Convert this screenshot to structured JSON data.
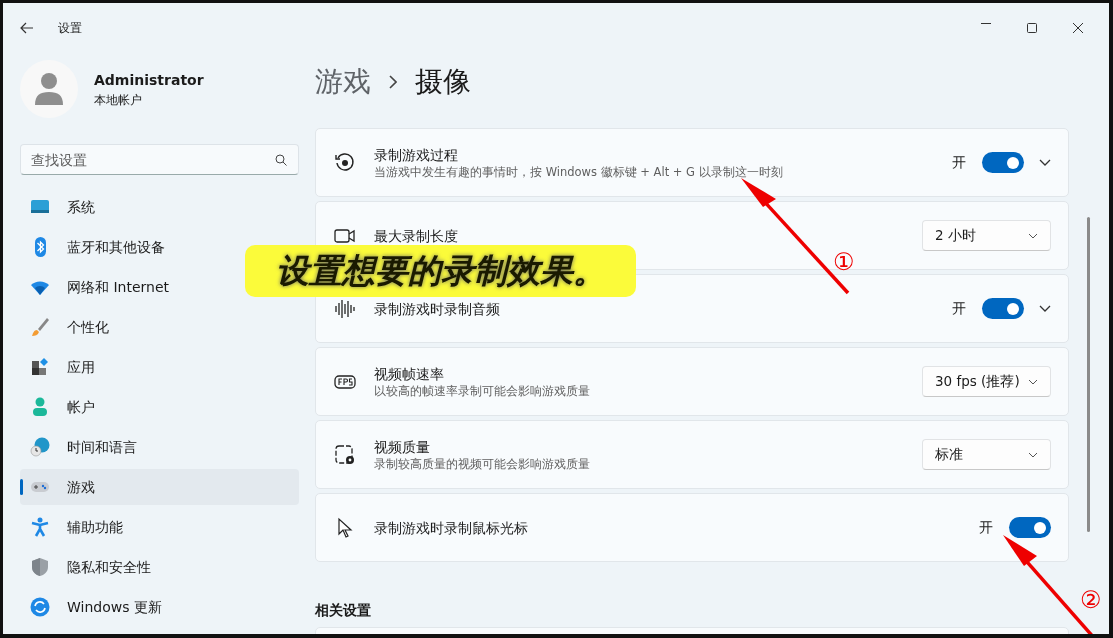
{
  "window": {
    "title": "设置"
  },
  "profile": {
    "name": "Administrator",
    "account_type": "本地帐户"
  },
  "search": {
    "placeholder": "查找设置"
  },
  "sidebar": {
    "items": [
      {
        "label": "系统",
        "selected": false
      },
      {
        "label": "蓝牙和其他设备",
        "selected": false
      },
      {
        "label": "网络和 Internet",
        "selected": false
      },
      {
        "label": "个性化",
        "selected": false
      },
      {
        "label": "应用",
        "selected": false
      },
      {
        "label": "帐户",
        "selected": false
      },
      {
        "label": "时间和语言",
        "selected": false
      },
      {
        "label": "游戏",
        "selected": true
      },
      {
        "label": "辅助功能",
        "selected": false
      },
      {
        "label": "隐私和安全性",
        "selected": false
      },
      {
        "label": "Windows 更新",
        "selected": false
      }
    ]
  },
  "breadcrumb": {
    "parent": "游戏",
    "current": "摄像"
  },
  "settings": [
    {
      "kind": "toggle",
      "title": "录制游戏过程",
      "description": "当游戏中发生有趣的事情时，按 Windows 徽标键 + Alt + G 以录制这一时刻",
      "state_label": "开",
      "on": true,
      "expandable": true
    },
    {
      "kind": "dropdown",
      "title": "最大录制长度",
      "value": "2 小时"
    },
    {
      "kind": "toggle",
      "title": "录制游戏时录制音频",
      "state_label": "开",
      "on": true,
      "expandable": true
    },
    {
      "kind": "dropdown",
      "title": "视频帧速率",
      "description": "以较高的帧速率录制可能会影响游戏质量",
      "value": "30 fps (推荐)"
    },
    {
      "kind": "dropdown",
      "title": "视频质量",
      "description": "录制较高质量的视频可能会影响游戏质量",
      "value": "标准"
    },
    {
      "kind": "toggle",
      "title": "录制游戏时录制鼠标光标",
      "state_label": "开",
      "on": true,
      "expandable": false
    }
  ],
  "related": {
    "heading": "相关设置"
  },
  "annotations": {
    "callout": "设置想要的录制效果。",
    "markers": [
      "①",
      "②"
    ]
  }
}
